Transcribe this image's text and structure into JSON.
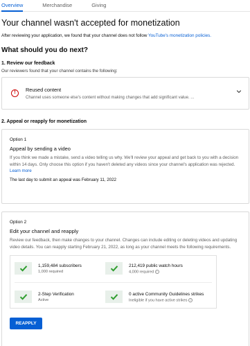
{
  "tabs": [
    {
      "label": "Overview"
    },
    {
      "label": "Merchandise"
    },
    {
      "label": "Giving"
    }
  ],
  "page_title": "Your channel wasn't accepted for monetization",
  "intro": {
    "text": "After reviewing your application, we found that your channel does not follow ",
    "link": "YouTube's monetization policies."
  },
  "next_heading": "What should you do next?",
  "review": {
    "heading": "1. Review our feedback",
    "sub": "Our reviewers found that your channel contains the following:",
    "item_title": "Reused content",
    "item_desc": "Channel uses someone else's content without making changes that add significant value. ...",
    "alert_glyph": "!",
    "icons": {
      "alert": "alert-circle-icon",
      "expand": "chevron-down-icon"
    }
  },
  "appeal": {
    "heading": "2. Appeal or reapply for monetization",
    "option1": {
      "label": "Option 1",
      "title": "Appeal by sending a video",
      "text": "If you think we made a mistake, send a video telling us why. We'll review your appeal and get back to you with a decision within 14 days. Only choose this option if you haven't deleted any videos since your channel's application was rejected. ",
      "link": "Learn more",
      "deadline": "The last day to submit an appeal was February 11, 2022"
    },
    "option2": {
      "label": "Option 2",
      "title": "Edit your channel and reapply",
      "text": "Review our feedback, then make changes to your channel. Changes can include editing or deleting videos and updating video details. You can reapply starting February 21, 2022, as long as your channel meets the following requirements.",
      "requirements": [
        {
          "main": "1,159,484 subscribers",
          "sub": "1,000 required",
          "info": false
        },
        {
          "main": "212,419 public watch hours",
          "sub": "4,000 required",
          "info": true
        },
        {
          "main": "2-Step Verification",
          "sub": "Active",
          "info": false
        },
        {
          "main": "0 active Community Guidelines strikes",
          "sub": "Ineligible if you have active strikes",
          "info": true
        }
      ],
      "info_glyph": "i",
      "button": "REAPPLY"
    }
  },
  "colors": {
    "accent": "#065fd4",
    "check": "#2e9e2e",
    "alert": "#cc0000"
  }
}
